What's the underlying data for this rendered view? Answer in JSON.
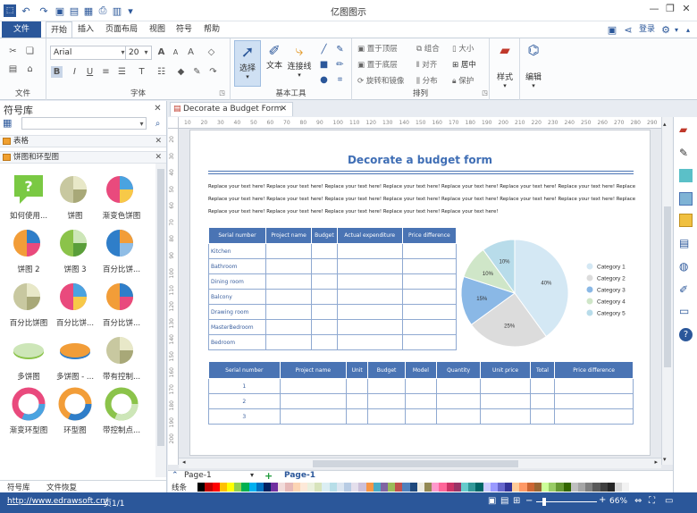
{
  "app_title": "亿图图示",
  "ribbon_tabs": [
    "文件",
    "开始",
    "插入",
    "页面布局",
    "视图",
    "符号",
    "帮助"
  ],
  "login_label": "登录",
  "font": {
    "name": "Arial",
    "size": "20"
  },
  "groups": {
    "file": "文件",
    "font": "字体",
    "basic_tools": "基本工具",
    "arrange": "排列"
  },
  "tools": {
    "select": "选择",
    "text": "文本",
    "connector": "连接线",
    "style": "样式",
    "edit": "编辑"
  },
  "arrange_items": [
    "置于顶层",
    "置于底层",
    "旋转和镜像",
    "组合",
    "对齐",
    "分布",
    "大小",
    "居中",
    "保护"
  ],
  "library": {
    "title": "符号库",
    "categories": [
      "表格",
      "饼图和环型图"
    ],
    "shapes": [
      "如何使用...",
      "饼图",
      "渐变色饼图",
      "饼图 2",
      "饼图 3",
      "百分比饼...",
      "百分比饼图",
      "百分比饼...",
      "百分比饼...",
      "多饼图",
      "多饼图 - ...",
      "带有控制...",
      "渐变环型图",
      "环型图",
      "带控制点..."
    ],
    "bottom_tabs": [
      "符号库",
      "文件恢复"
    ]
  },
  "document_tab": "Decorate a Budget Form",
  "ruler_h": [
    "10",
    "20",
    "30",
    "40",
    "50",
    "60",
    "70",
    "80",
    "90",
    "100",
    "110",
    "120",
    "130",
    "140",
    "150",
    "160",
    "170",
    "180",
    "190",
    "200",
    "210",
    "220",
    "230",
    "240",
    "250",
    "260",
    "270",
    "280",
    "290"
  ],
  "ruler_v": [
    "20",
    "30",
    "40",
    "50",
    "60",
    "70",
    "80",
    "90",
    "100",
    "110",
    "120",
    "130",
    "140",
    "150",
    "160",
    "170",
    "180",
    "190",
    "200"
  ],
  "doc": {
    "title": "Decorate a budget form",
    "para_lines": [
      "Replace your text here! Replace your text here! Replace your text here! Replace your text here! Replace your text here! Replace your text here! Replace your text here! Replace your text here!",
      "Replace your text here! Replace your text here! Replace your text here! Replace your text here! Replace your text here! Replace your text here! Replace your text here! Replace your text here!",
      "Replace your text here! Replace your text here! Replace your text here! Replace your text here! Replace your text here!"
    ],
    "table1_headers": [
      "Serial number",
      "Project name",
      "Budget",
      "Actual expenditure",
      "Price difference"
    ],
    "table1_rows": [
      "Kitchen",
      "Bathroom",
      "Dining room",
      "Balcony",
      "Drawing room",
      "MasterBedroom",
      "Bedroom"
    ],
    "table2_headers": [
      "Serial number",
      "Project name",
      "Unit",
      "Budget",
      "Model",
      "Quantity",
      "Unit price",
      "Total",
      "Price difference"
    ],
    "table2_rows": [
      "1",
      "2",
      "3"
    ]
  },
  "chart_data": {
    "type": "pie",
    "series": [
      {
        "values": [
          40,
          25,
          15,
          10,
          10
        ]
      }
    ],
    "categories": [
      "Category 1",
      "Category 2",
      "Category 3",
      "Category 4",
      "Category 5"
    ],
    "labels": [
      "40%",
      "25%",
      "15%",
      "10%",
      "10%"
    ],
    "colors": [
      "#d4e8f4",
      "#dcdcdc",
      "#8ab8e6",
      "#cfe6c8",
      "#b8dcea"
    ],
    "legend": "right"
  },
  "page_tabs": [
    "Page-1",
    "Page-1"
  ],
  "palette_label": "线条",
  "status": {
    "url": "http://www.edrawsoft.cn/",
    "page": "页1/1",
    "zoom": "66%"
  },
  "palette_colors": [
    "#ffffff",
    "#000000",
    "#c00000",
    "#ff0000",
    "#ffc000",
    "#ffff00",
    "#92d050",
    "#00b050",
    "#00b0f0",
    "#0070c0",
    "#002060",
    "#7030a0",
    "#f2dcdb",
    "#e6b9b8",
    "#fcd5b4",
    "#fde9d9",
    "#ebf1de",
    "#d8e4bc",
    "#dbeef3",
    "#b7dee8",
    "#dce6f1",
    "#b8cce4",
    "#e4dfec",
    "#ccc0da",
    "#f79646",
    "#4bacc6",
    "#8064a2",
    "#9bbb59",
    "#c0504d",
    "#4f81bd",
    "#1f497d",
    "#eeece1",
    "#938953",
    "#ff99cc",
    "#ff6699",
    "#cc3366",
    "#993366",
    "#66cccc",
    "#339999",
    "#006666",
    "#ccccff",
    "#9999ff",
    "#6666cc",
    "#333399",
    "#ffcc99",
    "#ff9966",
    "#cc6633",
    "#996633",
    "#ccff99",
    "#99cc66",
    "#669933",
    "#336600",
    "#bfbfbf",
    "#a5a5a5",
    "#7f7f7f",
    "#595959",
    "#404040",
    "#262626",
    "#d9d9d9",
    "#f2f2f2"
  ]
}
